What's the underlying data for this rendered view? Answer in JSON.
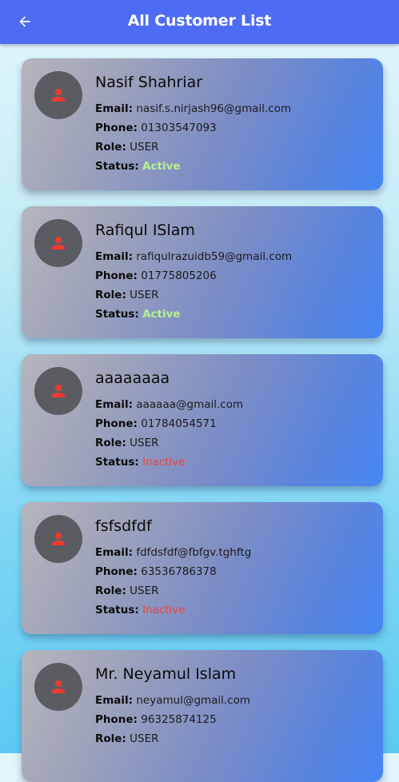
{
  "header": {
    "title": "All Customer List",
    "back_icon": "arrow-back-icon"
  },
  "labels": {
    "email": "Email:",
    "phone": "Phone:",
    "role": "Role:",
    "status": "Status:"
  },
  "customers": [
    {
      "name": "Nasif Shahriar",
      "email": "nasif.s.nirjash96@gmail.com",
      "phone": "01303547093",
      "role": "USER",
      "status": "Active"
    },
    {
      "name": "Rafiqul ISlam",
      "email": "rafiqulrazuidb59@gmail.com",
      "phone": "01775805206",
      "role": "USER",
      "status": "Active"
    },
    {
      "name": "aaaaaaaa",
      "email": "aaaaaa@gmail.com",
      "phone": "01784054571",
      "role": "USER",
      "status": "Inactive"
    },
    {
      "name": "fsfsdfdf",
      "email": "fdfdsfdf@fbfgv.tghftg",
      "phone": "63536786378",
      "role": "USER",
      "status": "Inactive"
    },
    {
      "name": "Mr. Neyamul Islam",
      "email": "neyamul@gmail.com",
      "phone": "96325874125",
      "role": "USER",
      "status": ""
    }
  ],
  "colors": {
    "app_bar": "#4e6cf3",
    "status_active": "#b6f18a",
    "status_inactive": "#e8453c",
    "avatar_bg": "#5b5c62",
    "avatar_icon": "#f03a30"
  }
}
